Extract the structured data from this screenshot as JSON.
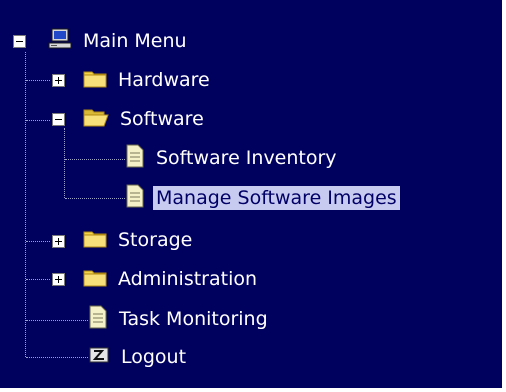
{
  "tree": {
    "root": {
      "label": "Main Menu",
      "icon": "computer-icon",
      "toggle": "collapse"
    },
    "items": [
      {
        "label": "Hardware",
        "icon": "folder-closed-icon",
        "toggle": "expand"
      },
      {
        "label": "Software",
        "icon": "folder-open-icon",
        "toggle": "collapse",
        "children": [
          {
            "label": "Software Inventory",
            "icon": "page-icon"
          },
          {
            "label": "Manage Software Images",
            "icon": "page-icon",
            "selected": true
          }
        ]
      },
      {
        "label": "Storage",
        "icon": "folder-closed-icon",
        "toggle": "expand"
      },
      {
        "label": "Administration",
        "icon": "folder-closed-icon",
        "toggle": "expand"
      },
      {
        "label": "Task Monitoring",
        "icon": "page-icon"
      },
      {
        "label": "Logout",
        "icon": "logout-icon"
      }
    ]
  },
  "colors": {
    "background": "#00005f",
    "selection": "#c8cbf0",
    "text": "#ffffff",
    "tree_line": "#9aa0c8",
    "folder": "#f2d34a"
  }
}
